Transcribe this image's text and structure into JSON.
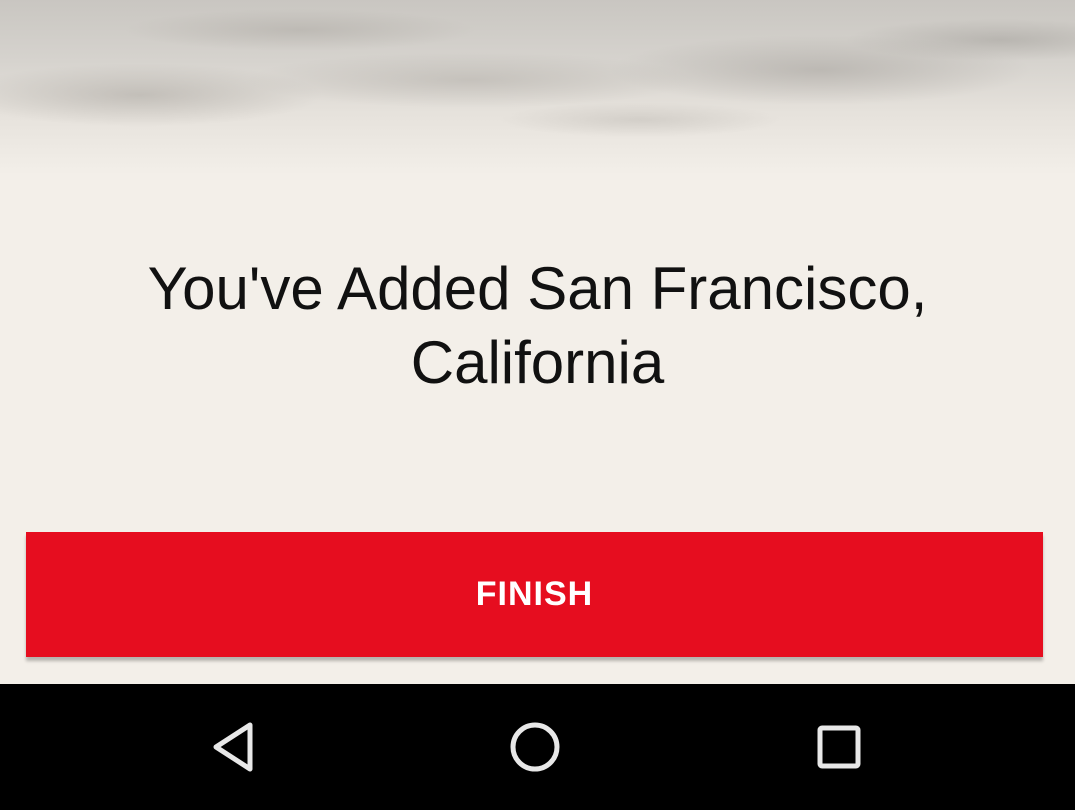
{
  "header": {
    "image": "cloudy-sky-banner"
  },
  "main": {
    "headline_line1": "You've Added San Francisco,",
    "headline_line2": "California"
  },
  "actions": {
    "finish_label": "FINISH"
  },
  "navigation_bar": {
    "back_icon": "back-triangle-icon",
    "home_icon": "home-circle-icon",
    "recents_icon": "recents-square-icon"
  },
  "colors": {
    "background": "#f3efe9",
    "accent": "#e60d1f",
    "text": "#111111",
    "nav_bar": "#000000"
  }
}
